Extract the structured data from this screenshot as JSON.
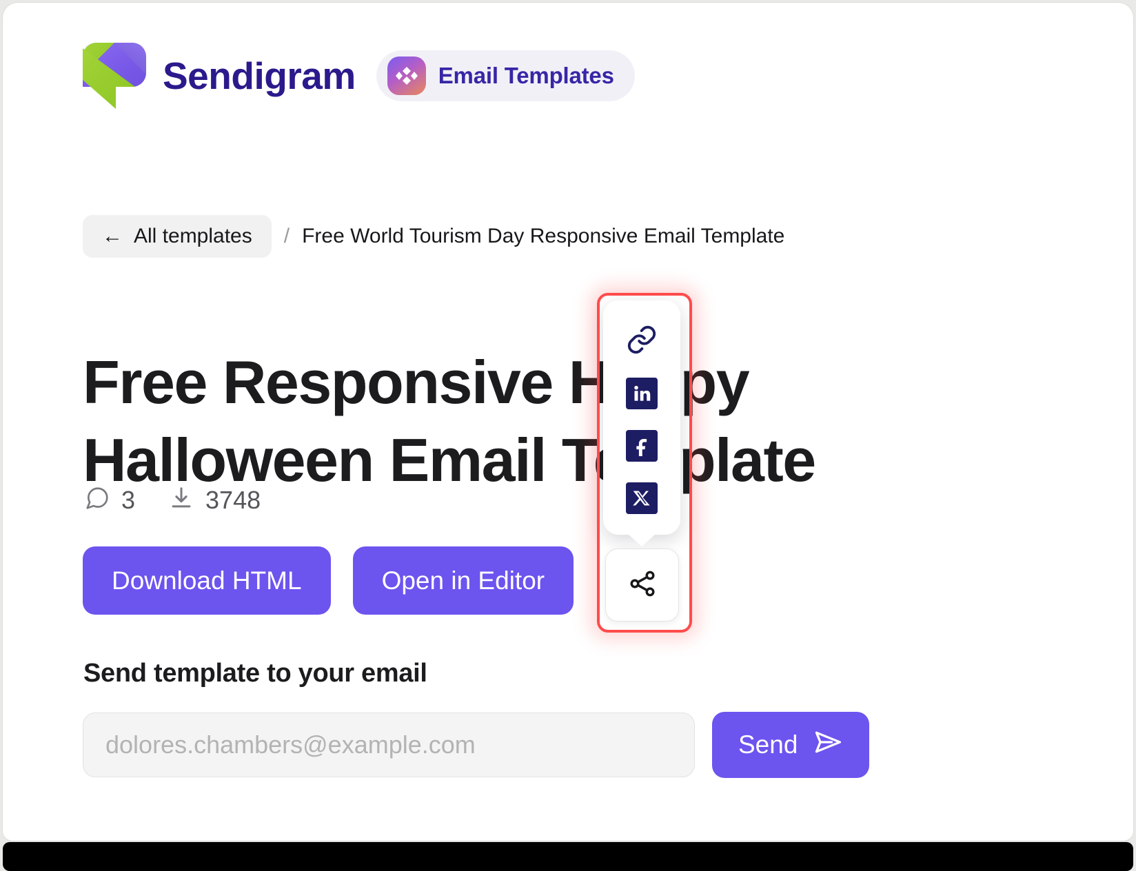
{
  "brand": {
    "name": "Sendigram",
    "logo_icon": "sendigram-leaf-logo",
    "badge": {
      "label": "Email Templates",
      "icon": "diamond-grid-icon",
      "gradient_from": "#7b5cf0",
      "gradient_to": "#e8895a"
    }
  },
  "breadcrumb": {
    "back_arrow": "←",
    "back_label": "All templates",
    "separator": "/",
    "current": "Free World Tourism Day Responsive Email Template"
  },
  "page": {
    "title": "Free Responsive Happy Halloween Email Template"
  },
  "stats": [
    {
      "icon": "comment-icon",
      "value": "3",
      "name": "comments"
    },
    {
      "icon": "download-icon",
      "value": "3748",
      "name": "downloads"
    }
  ],
  "actions": {
    "download_html": "Download HTML",
    "open_in_editor": "Open in Editor",
    "accent_color": "#6c54ef"
  },
  "share": {
    "button_icon": "share-icon",
    "highlight_color": "#ff4b4b",
    "items": [
      {
        "icon": "link-icon",
        "label": "Copy link"
      },
      {
        "icon": "linkedin-icon",
        "label": "LinkedIn"
      },
      {
        "icon": "facebook-icon",
        "label": "Facebook"
      },
      {
        "icon": "x-twitter-icon",
        "label": "X"
      }
    ],
    "icon_color": "#1d1d63"
  },
  "email_form": {
    "heading": "Send template to your email",
    "placeholder": "dolores.chambers@example.com",
    "value": "",
    "send_label": "Send",
    "send_icon": "paper-plane-icon"
  }
}
